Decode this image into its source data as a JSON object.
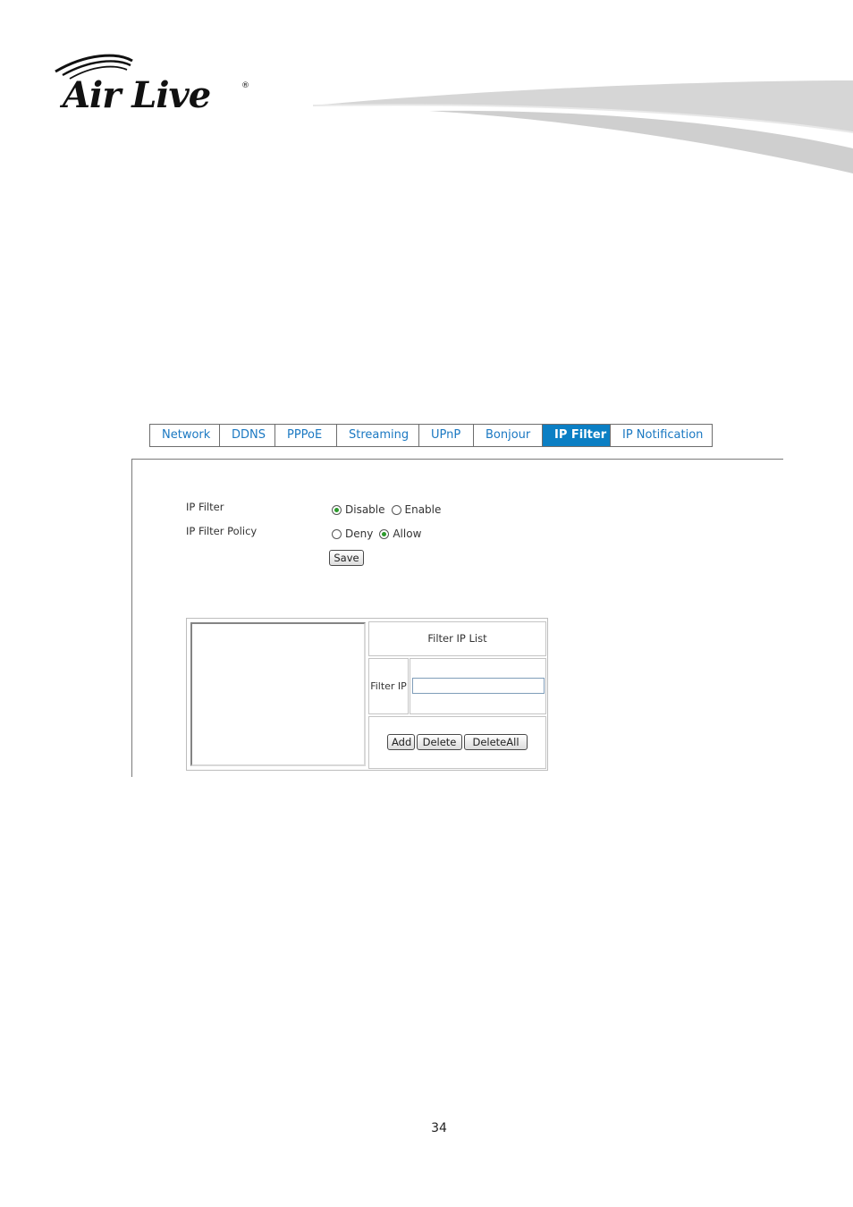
{
  "brand": {
    "logo_text": "AirLive"
  },
  "tabs": [
    {
      "label": "Network",
      "active": false
    },
    {
      "label": "DDNS",
      "active": false
    },
    {
      "label": "PPPoE",
      "active": false
    },
    {
      "label": "Streaming",
      "active": false
    },
    {
      "label": "UPnP",
      "active": false
    },
    {
      "label": "Bonjour",
      "active": false
    },
    {
      "label": "IP Filter",
      "active": true
    },
    {
      "label": "IP Notification",
      "active": false
    }
  ],
  "settings": {
    "ip_filter_label": "IP Filter",
    "ip_filter_options": [
      {
        "label": "Disable",
        "checked": true
      },
      {
        "label": "Enable",
        "checked": false
      }
    ],
    "policy_label": "IP Filter Policy",
    "policy_options": [
      {
        "label": "Deny",
        "checked": false
      },
      {
        "label": "Allow",
        "checked": true
      }
    ],
    "save_label": "Save"
  },
  "filter_list": {
    "header": "Filter IP List",
    "filter_ip_label": "Filter IP",
    "filter_ip_value": "",
    "entries": [],
    "add_label": "Add",
    "delete_label": "Delete",
    "delete_all_label": "DeleteAll"
  },
  "page_number": "34",
  "colors": {
    "accent": "#0b7fc4",
    "tab_text": "#1a78c2",
    "radio_check": "#2b9a2b"
  }
}
